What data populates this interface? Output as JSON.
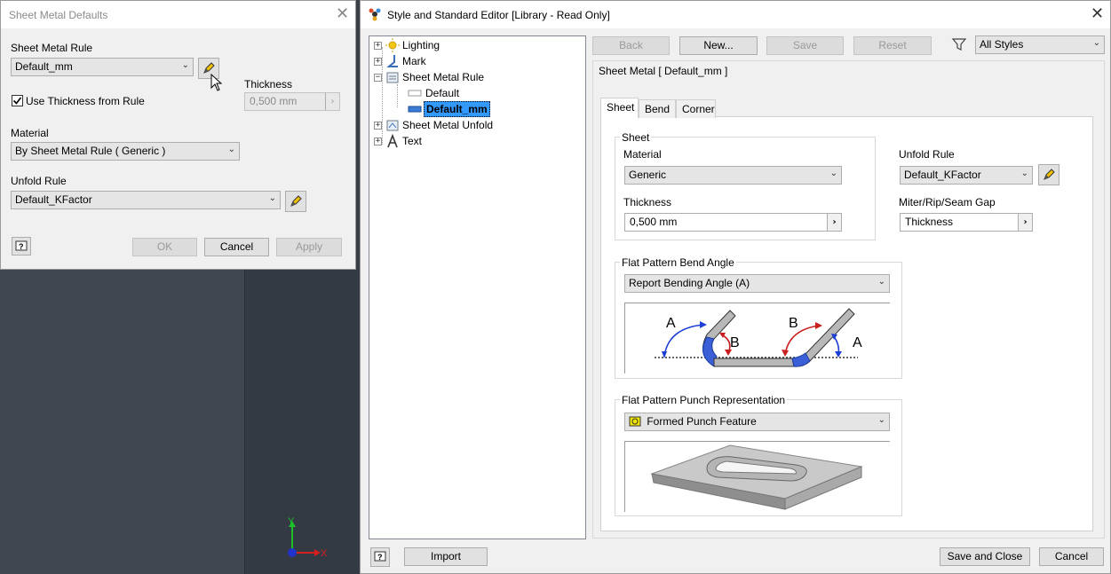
{
  "left_dialog": {
    "title": "Sheet Metal Defaults",
    "sheet_metal_rule_label": "Sheet Metal Rule",
    "sheet_metal_rule_value": "Default_mm",
    "use_thickness_label": "Use Thickness from Rule",
    "use_thickness_checked": true,
    "thickness_label": "Thickness",
    "thickness_value": "0,500 mm",
    "material_label": "Material",
    "material_value": "By Sheet Metal Rule ( Generic )",
    "unfold_rule_label": "Unfold Rule",
    "unfold_rule_value": "Default_KFactor",
    "ok_label": "OK",
    "cancel_label": "Cancel",
    "apply_label": "Apply"
  },
  "viewport": {
    "axis_y": "Y",
    "axis_x": "X"
  },
  "editor": {
    "title": "Style and Standard Editor [Library - Read Only]",
    "toolbar": {
      "back": "Back",
      "new": "New...",
      "save": "Save",
      "reset": "Reset",
      "filter_value": "All Styles"
    },
    "tree": [
      {
        "label": "Lighting",
        "icon": "lighting-icon"
      },
      {
        "label": "Mark",
        "icon": "mark-icon"
      },
      {
        "label": "Sheet Metal Rule",
        "icon": "sheet-metal-rule-icon"
      },
      {
        "label": "Default",
        "icon": "rule-style-icon"
      },
      {
        "label": "Default_mm",
        "icon": "rule-style-icon",
        "selected": true
      },
      {
        "label": "Sheet Metal Unfold",
        "icon": "sheet-metal-unfold-icon"
      },
      {
        "label": "Text",
        "icon": "text-icon"
      }
    ],
    "panel_title": "Sheet Metal [ Default_mm ]",
    "tabs": [
      "Sheet",
      "Bend",
      "Corner"
    ],
    "sheet_group": {
      "title": "Sheet",
      "material_label": "Material",
      "material_value": "Generic",
      "thickness_label": "Thickness",
      "thickness_value": "0,500 mm"
    },
    "unfold_rule_label": "Unfold Rule",
    "unfold_rule_value": "Default_KFactor",
    "miter_label": "Miter/Rip/Seam Gap",
    "miter_value": "Thickness",
    "bend_angle_group": {
      "title": "Flat Pattern Bend Angle",
      "value": "Report Bending Angle (A)",
      "label_a": "A",
      "label_b": "B"
    },
    "punch_group": {
      "title": "Flat Pattern Punch Representation",
      "value": "Formed Punch Feature"
    },
    "import_label": "Import",
    "save_close_label": "Save and Close",
    "cancel_label": "Cancel"
  },
  "colors": {
    "selection": "#3399ff",
    "arrow_blue": "#1d3fd6",
    "arrow_red": "#c81e1e"
  }
}
